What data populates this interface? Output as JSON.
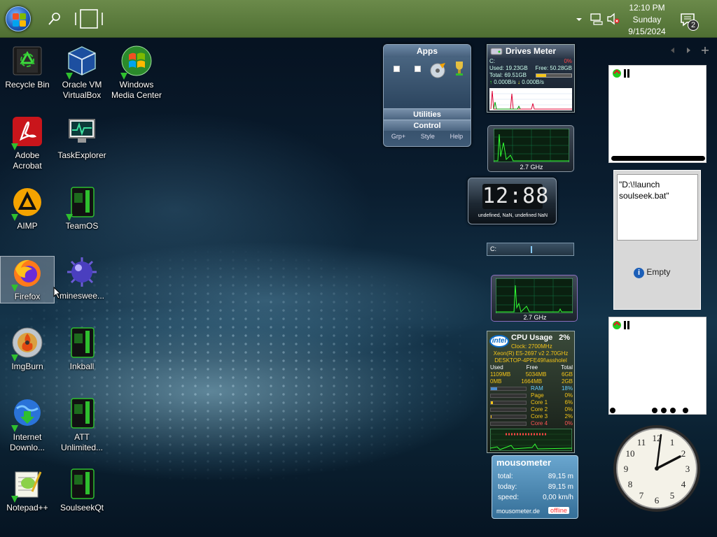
{
  "taskbar": {
    "time": "12:10 PM",
    "day": "Sunday",
    "date": "9/15/2024",
    "notification_count": "2"
  },
  "desktop_icons": [
    {
      "label": "Recycle Bin"
    },
    {
      "label": "Oracle VM VirtualBox"
    },
    {
      "label": "Windows Media Center"
    },
    {
      "label": "Adobe Acrobat"
    },
    {
      "label": "TaskExplorer"
    },
    {
      "label": "AIMP"
    },
    {
      "label": "TeamOS"
    },
    {
      "label": "Firefox"
    },
    {
      "label": "mineswee..."
    },
    {
      "label": "ImgBurn"
    },
    {
      "label": "Inkball"
    },
    {
      "label": "Internet Downlo..."
    },
    {
      "label": "ATT Unlimited..."
    },
    {
      "label": "Notepad++"
    },
    {
      "label": "SoulseekQt"
    }
  ],
  "apps_gadget": {
    "title": "Apps",
    "row1": "Utilities",
    "row2": "Control",
    "foot": [
      "Grp+",
      "Style",
      "Help"
    ]
  },
  "drives_meter": {
    "title": "Drives Meter",
    "drive": "C:",
    "percent": "0%",
    "used": "Used: 19.23GB",
    "free": "Free: 50.28GB",
    "total": "Total: 69.51GB",
    "read": "0.000B/s",
    "write": "0.000B/s"
  },
  "cpu_meter_1": {
    "freq": "2.7 GHz"
  },
  "cpu_meter_2": {
    "freq": "2.7 GHz"
  },
  "digital_clock": {
    "time": "12:88",
    "sub": "undefined, NaN, undefined NaN"
  },
  "disk_bar": {
    "label": "C:"
  },
  "cpu_usage": {
    "title": "CPU Usage",
    "percent": "2%",
    "clock": "Clock: 2700MHz",
    "model": "Xeon(R) E5-2697 v2 2.70GHz",
    "user": "DESKTOP-4PFE49I\\assholel",
    "headers": [
      "Used",
      "Free",
      "Total"
    ],
    "ram_row": [
      "1109MB",
      "5034MB",
      "6GB"
    ],
    "page_row": [
      "0MB",
      "1664MB",
      "2GB"
    ],
    "rows": [
      {
        "name": "RAM",
        "value": "18%"
      },
      {
        "name": "Page",
        "value": "0%"
      },
      {
        "name": "Core 1",
        "value": "6%"
      },
      {
        "name": "Core 2",
        "value": "0%"
      },
      {
        "name": "Core 3",
        "value": "2%"
      },
      {
        "name": "Core 4",
        "value": "0%"
      }
    ]
  },
  "mousometer": {
    "title": "mousometer",
    "total_label": "total:",
    "total": "89,15 m",
    "today_label": "today:",
    "today": "89,15 m",
    "speed_label": "speed:",
    "speed": "0,00 km/h",
    "site": "mousometer.de",
    "status": "offline"
  },
  "launch_gadget": {
    "path": "\"D:\\!launch soulseek.bat\"",
    "status": "Empty"
  },
  "colors": {
    "taskbar": "#5a7a3c",
    "accent_green": "#22cc44"
  }
}
